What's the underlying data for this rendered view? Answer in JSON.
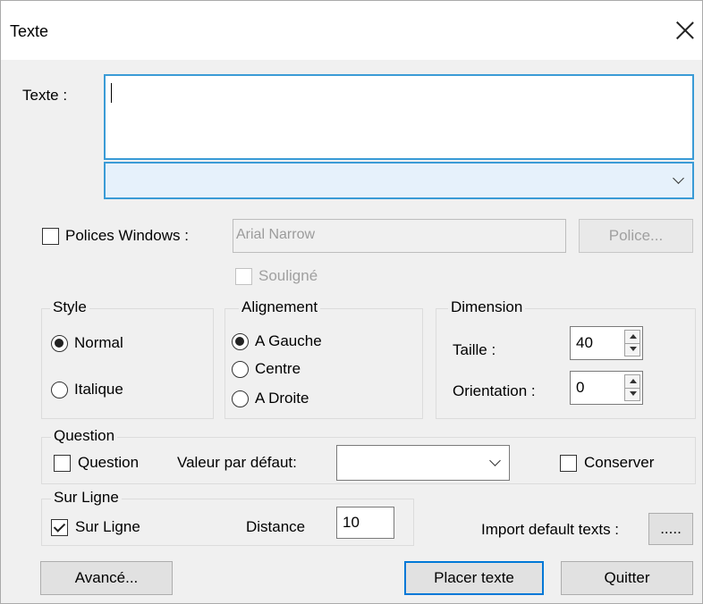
{
  "window": {
    "title": "Texte"
  },
  "texte": {
    "label": "Texte :",
    "value": "",
    "combo_value": ""
  },
  "font": {
    "checkbox_label": "Polices Windows :",
    "checked": false,
    "font_name": "Arial Narrow",
    "police_button": "Police...",
    "souligne_label": "Souligné",
    "souligne_checked": false
  },
  "style": {
    "title": "Style",
    "options": [
      "Normal",
      "Italique"
    ],
    "selected": "Normal"
  },
  "alignement": {
    "title": "Alignement",
    "options": [
      "A Gauche",
      "Centre",
      "A Droite"
    ],
    "selected": "A Gauche"
  },
  "dimension": {
    "title": "Dimension",
    "taille_label": "Taille :",
    "taille_value": "40",
    "orientation_label": "Orientation :",
    "orientation_value": "0"
  },
  "question": {
    "title": "Question",
    "checkbox_label": "Question",
    "checked": false,
    "default_label": "Valeur par défaut:",
    "default_value": "",
    "conserver_label": "Conserver",
    "conserver_checked": false
  },
  "surligne": {
    "title": "Sur Ligne",
    "checkbox_label": "Sur Ligne",
    "checked": true,
    "distance_label": "Distance",
    "distance_value": "10"
  },
  "import": {
    "label": "Import default texts :",
    "button": "....."
  },
  "buttons": {
    "avance": "Avancé...",
    "placer": "Placer texte",
    "quitter": "Quitter"
  }
}
